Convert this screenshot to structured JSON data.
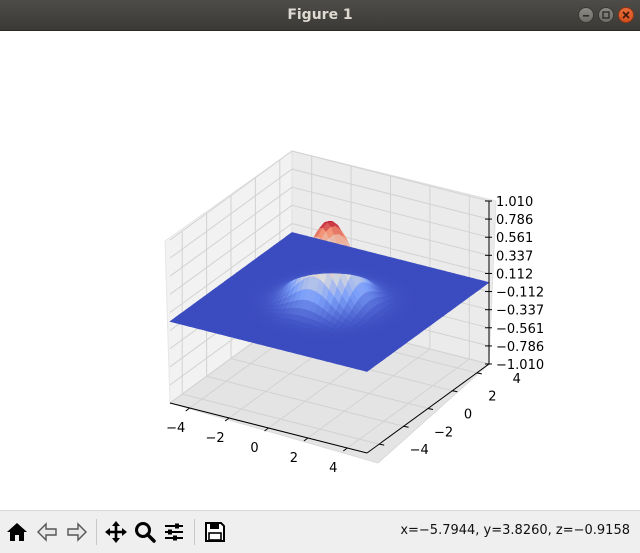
{
  "window": {
    "title": "Figure 1"
  },
  "toolbar": {
    "buttons": [
      {
        "name": "home-button",
        "icon": "home-icon"
      },
      {
        "name": "back-button",
        "icon": "arrow-left-icon"
      },
      {
        "name": "forward-button",
        "icon": "arrow-right-icon"
      },
      {
        "name": "pan-button",
        "icon": "move-icon"
      },
      {
        "name": "zoom-button",
        "icon": "magnifier-icon"
      },
      {
        "name": "configure-subplots-button",
        "icon": "sliders-icon"
      },
      {
        "name": "save-button",
        "icon": "floppy-disk-icon"
      }
    ],
    "coords": "x=−5.7944, y=3.8260, z=−0.9158"
  },
  "chart_data": {
    "type": "surface",
    "colormap": "coolwarm",
    "z_function": "gaussian exp(-(x^2+y^2)/2)",
    "x_range": [
      -5,
      5
    ],
    "y_range": [
      -5,
      5
    ],
    "zlim": [
      -1.01,
      1.01
    ],
    "x_tick_labels": [
      "−4",
      "−2",
      "0",
      "2",
      "4"
    ],
    "y_tick_labels": [
      "−4",
      "−2",
      "0",
      "2",
      "4"
    ],
    "z_tick_labels": [
      "1.010",
      "0.786",
      "0.561",
      "0.337",
      "0.112",
      "−0.112",
      "−0.337",
      "−0.561",
      "−0.786",
      "−1.010"
    ],
    "grid": true,
    "colors": {
      "low": "#3b4cc0",
      "high": "#b40426",
      "pane": "#f2f2f2"
    }
  }
}
